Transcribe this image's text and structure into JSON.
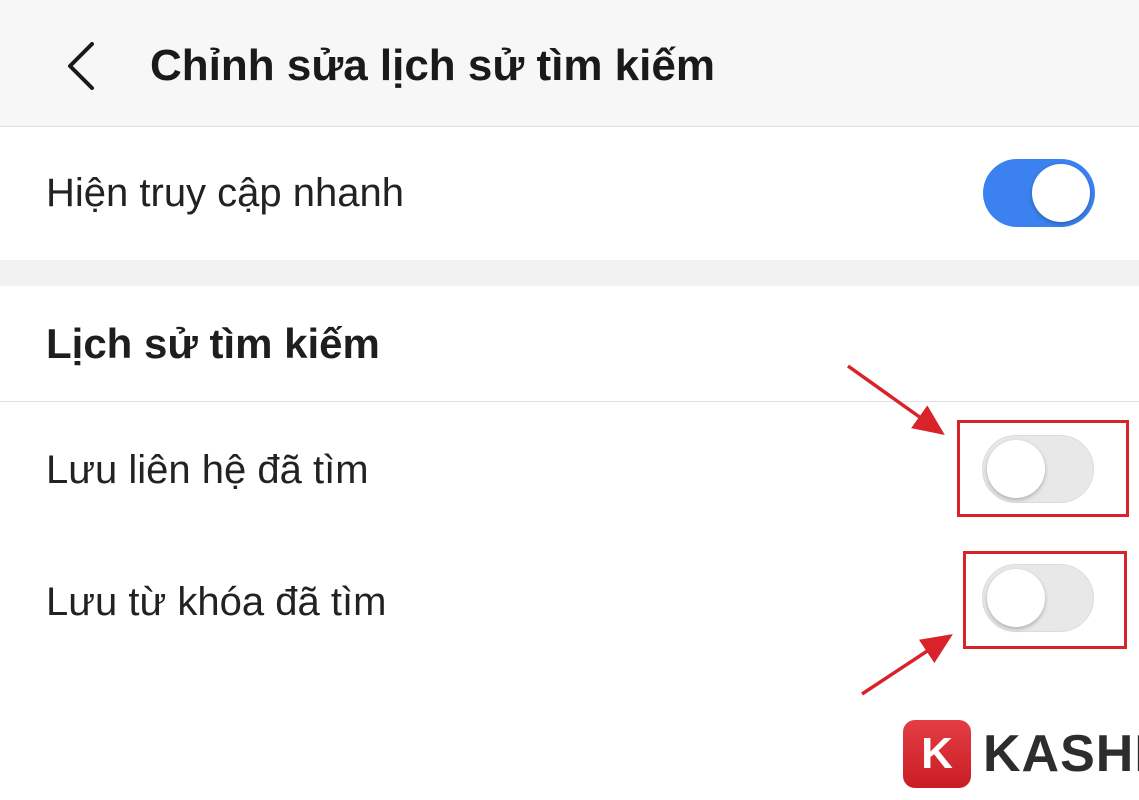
{
  "header": {
    "back_icon": "chevron-left-icon",
    "title": "Chỉnh sửa lịch sử tìm kiếm"
  },
  "settings": {
    "quick_access": {
      "label": "Hiện truy cập nhanh",
      "enabled": true
    },
    "search_history_section": {
      "title": "Lịch sử tìm kiếm"
    },
    "save_contacts": {
      "label": "Lưu liên hệ đã tìm",
      "enabled": false
    },
    "save_keywords": {
      "label": "Lưu từ khóa đã tìm",
      "enabled": false
    }
  },
  "annotations": {
    "highlight_color": "#d9232b",
    "arrow_color": "#d9232b"
  },
  "colors": {
    "toggle_on": "#3b82f0",
    "toggle_off": "#e8e8e8"
  },
  "watermark": {
    "badge_letter": "K",
    "text": "KASHI"
  }
}
